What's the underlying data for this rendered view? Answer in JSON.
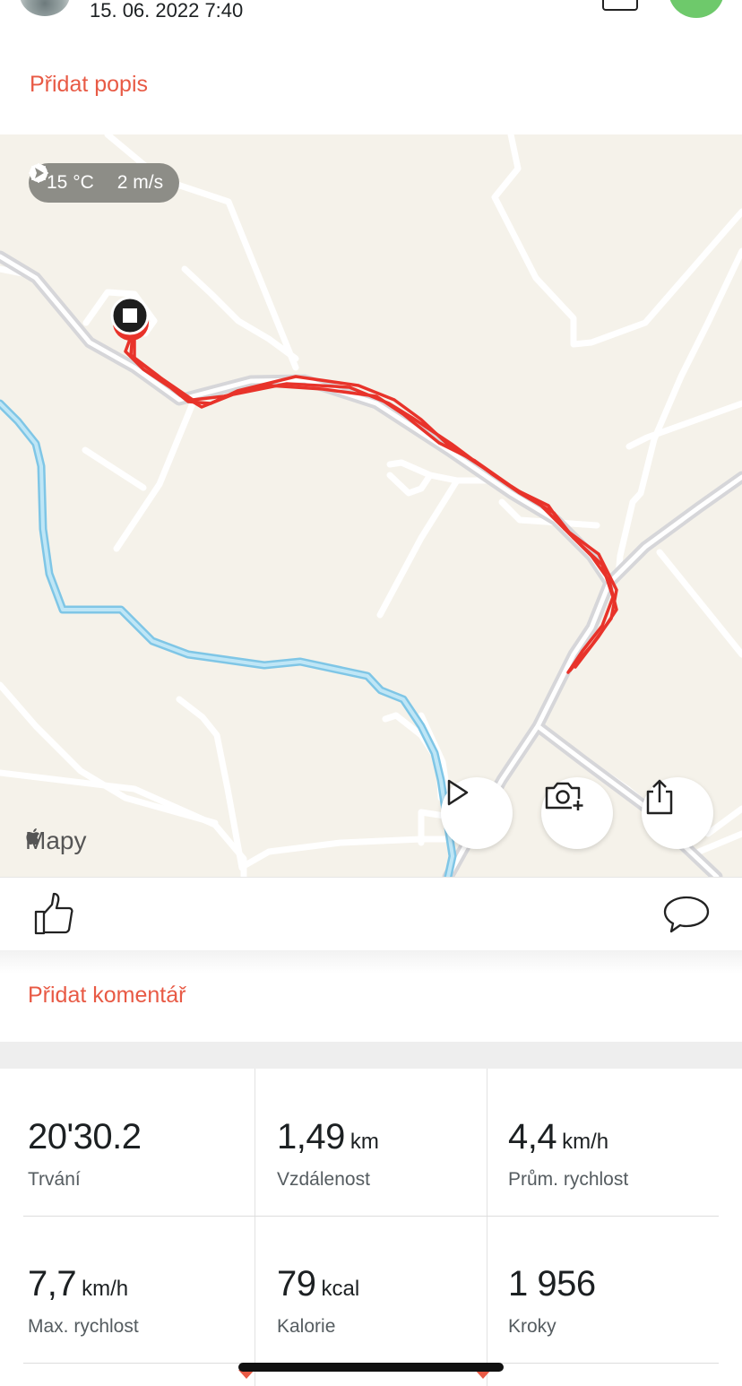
{
  "header": {
    "date": "15. 06. 2022 7:40",
    "add_description": "Přidat popis"
  },
  "map": {
    "weather": {
      "temperature": "15 °C",
      "wind": "2 m/s",
      "temp_icon": "sun-icon",
      "wind_icon": "wind-direction-icon"
    },
    "attribution": "Mapy",
    "buttons": [
      "play-icon",
      "add-photo-icon",
      "share-icon"
    ],
    "route_color": "#e8332a",
    "water_color": "#9fd6ef"
  },
  "social": {
    "like_icon": "thumbs-up-icon",
    "comment_icon": "speech-bubble-icon",
    "add_comment": "Přidat komentář"
  },
  "stats": [
    {
      "value": "20'30.2",
      "unit": "",
      "label": "Trvání"
    },
    {
      "value": "1,49",
      "unit": "km",
      "label": "Vzdálenost"
    },
    {
      "value": "4,4",
      "unit": "km/h",
      "label": "Prům. rychlost"
    },
    {
      "value": "7,7",
      "unit": "km/h",
      "label": "Max. rychlost"
    },
    {
      "value": "79",
      "unit": "kcal",
      "label": "Kalorie"
    },
    {
      "value": "1 956",
      "unit": "",
      "label": "Kroky"
    }
  ],
  "colors": {
    "accent": "#e85a45",
    "text": "#1c2022",
    "muted": "#555c60"
  }
}
